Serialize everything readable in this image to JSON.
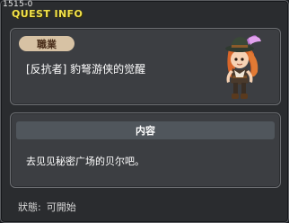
{
  "window": {
    "quest_id": "1515-0",
    "title": "QUEST INFO"
  },
  "job": {
    "tag_label": "職業",
    "text": "[反抗者] 豹弩游侠的觉醒"
  },
  "content": {
    "header": "内容",
    "text": "去见见秘密广场的贝尔吧。"
  },
  "status": {
    "label": "狀態:",
    "value": "可開始"
  },
  "colors": {
    "title": "#f2e24a",
    "job_tag_bg": "#d7c2a4",
    "panel_bg": "#3c3e42",
    "content_bar_bg": "#50565c"
  },
  "icons": {
    "avatar": "npc-character-avatar"
  }
}
